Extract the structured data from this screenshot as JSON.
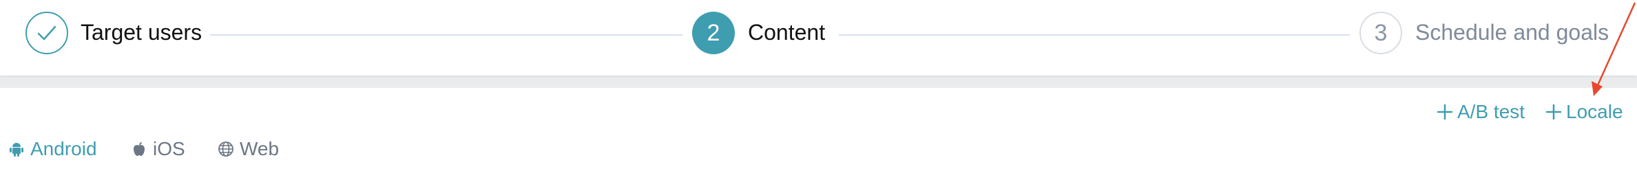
{
  "stepper": {
    "steps": [
      {
        "number": "",
        "label": "Target users",
        "state": "completed"
      },
      {
        "number": "2",
        "label": "Content",
        "state": "active"
      },
      {
        "number": "3",
        "label": "Schedule and goals",
        "state": "upcoming"
      }
    ]
  },
  "actions": {
    "ab_test_label": "A/B test",
    "locale_label": "Locale"
  },
  "platforms": [
    {
      "label": "Android",
      "icon": "android-icon",
      "selected": true
    },
    {
      "label": "iOS",
      "icon": "apple-icon",
      "selected": false
    },
    {
      "label": "Web",
      "icon": "globe-icon",
      "selected": false
    }
  ],
  "colors": {
    "accent": "#3f9db0",
    "annotation_arrow": "#e8472e",
    "muted_text": "#7f8a99"
  }
}
